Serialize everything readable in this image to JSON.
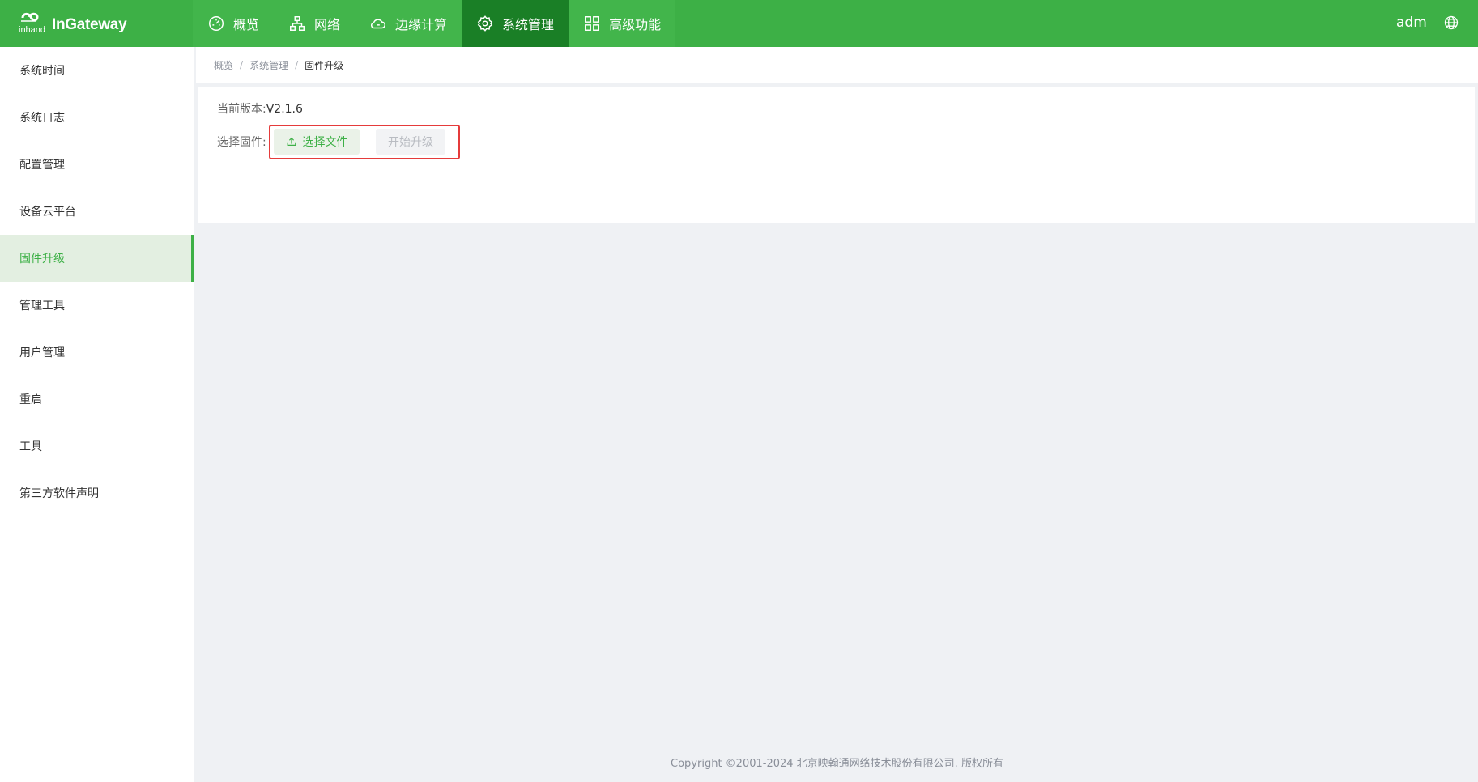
{
  "app": {
    "brand_small": "inhand",
    "brand": "InGateway",
    "user": "adm"
  },
  "nav": [
    {
      "label": "概览",
      "icon": "dashboard-icon"
    },
    {
      "label": "网络",
      "icon": "network-icon"
    },
    {
      "label": "边缘计算",
      "icon": "cloud-icon"
    },
    {
      "label": "系统管理",
      "icon": "gear-icon",
      "active": true
    },
    {
      "label": "高级功能",
      "icon": "grid-icon"
    }
  ],
  "sidebar": {
    "items": [
      {
        "label": "系统时间"
      },
      {
        "label": "系统日志"
      },
      {
        "label": "配置管理"
      },
      {
        "label": "设备云平台"
      },
      {
        "label": "固件升级",
        "active": true
      },
      {
        "label": "管理工具"
      },
      {
        "label": "用户管理"
      },
      {
        "label": "重启"
      },
      {
        "label": "工具"
      },
      {
        "label": "第三方软件声明"
      }
    ]
  },
  "breadcrumb": {
    "items": [
      "概览",
      "系统管理",
      "固件升级"
    ],
    "separator": "/"
  },
  "firmware": {
    "version_label": "当前版本:",
    "version_value": "V2.1.6",
    "select_label": "选择固件:",
    "choose_file_label": "选择文件",
    "start_upgrade_label": "开始升级"
  },
  "footer": {
    "text": "Copyright ©2001-2024 北京映翰通网络技术股份有限公司. 版权所有"
  },
  "colors": {
    "primary": "#3db046",
    "nav_active": "#1a7f26",
    "highlight": "#e53b3b"
  }
}
